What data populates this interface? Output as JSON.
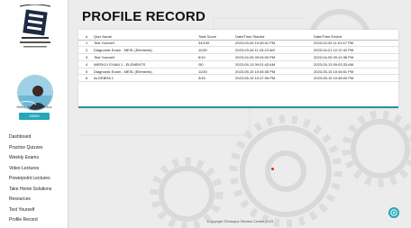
{
  "brand": {
    "logo_alt": "E3 Mechanical Engineering Review"
  },
  "user": {
    "greeting": "Hello, Juan Dela Cruz",
    "admin_label": "ADMIN"
  },
  "nav": {
    "items": [
      "Dashboard",
      "Practice Quizzes",
      "Weekly Exams",
      "Video Lectures",
      "Powerpoint Lectures",
      "Take Home Solutions",
      "Resources",
      "Test Yourself",
      "Profile Record"
    ]
  },
  "page": {
    "title": "PROFILE RECORD"
  },
  "table": {
    "headers": [
      "#",
      "Quiz Name",
      "Total Score",
      "Date/Time Started",
      "Date/Time Ended"
    ],
    "rows": [
      [
        "1",
        "Test Yourself",
        "34/100",
        "2023-03-26 10:45:31 PM",
        "2023-03-26 11:01:47 PM"
      ],
      [
        "2",
        "Diagnostic Exam - MESL (Elements)",
        "11/30",
        "2023-03-28 11:23:23 AM",
        "2023-04-21 12:12:42 PM"
      ],
      [
        "3",
        "Test Yourself",
        "6/10",
        "2023-04-05 09:04:00 PM",
        "2023-04-05 09:12:38 PM"
      ],
      [
        "4",
        "WEEKLY EXAM 1 - ELEMENTS",
        "/50",
        "2023-05-13 09:01:43 AM",
        "2023-05-13 09:03:33 AM"
      ],
      [
        "5",
        "Diagnostic Exam - MESL (Elements)",
        "11/30",
        "2023-05-15 10:45:35 PM",
        "2023-05-15 10:46:51 PM"
      ],
      [
        "6",
        "ALGEBRA 1",
        "3/15",
        "2023-05-15 10:47:06 PM",
        "2023-05-15 10:48:00 PM"
      ]
    ]
  },
  "footer": {
    "copyright": "Copyright ©Estoque Review Center 2023"
  },
  "icons": {
    "help": "help-icon",
    "logo": "e3-logo-icon"
  },
  "colors": {
    "accent": "#26a7ba",
    "card_border": "#2a8fa3"
  }
}
